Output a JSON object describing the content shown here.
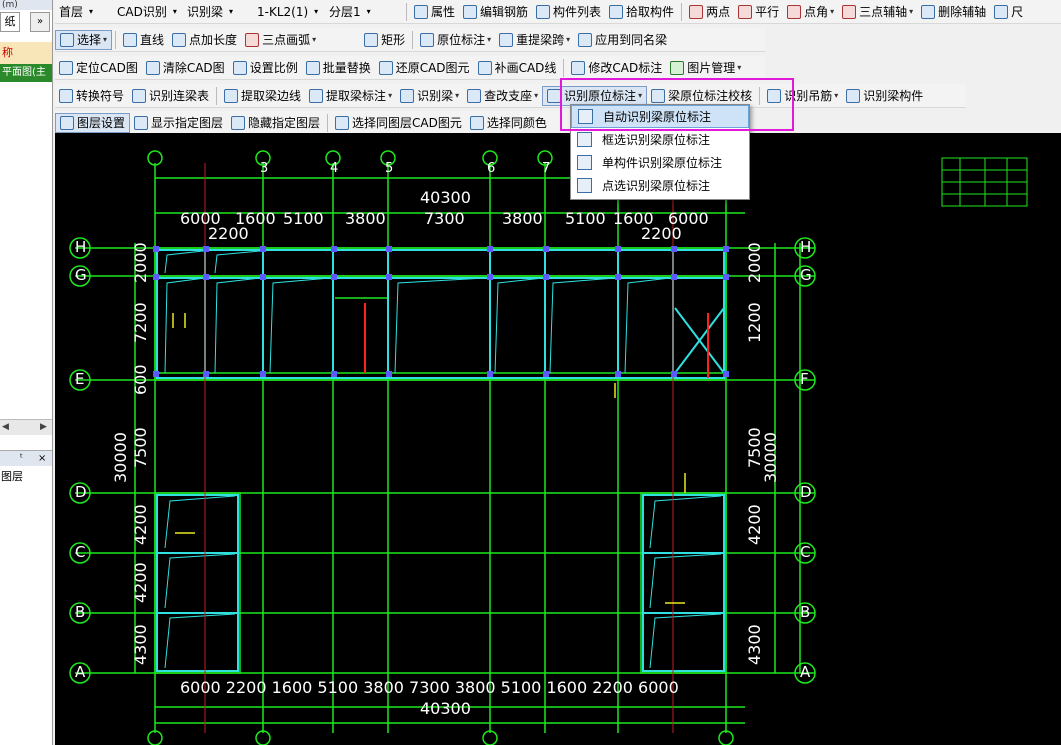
{
  "left_panel": {
    "head": "(m)",
    "tab": "纸",
    "chevron": "»",
    "name": "称",
    "plan": "平面图(主",
    "panel2_pin": "ᵗ",
    "panel2_close": "×",
    "layer": "图层"
  },
  "toolbar1": {
    "floor": "首层",
    "cad_recog": "CAD识别",
    "recog_beam": "识别梁",
    "component": "1-KL2(1)",
    "sublayer": "分层1",
    "items": [
      "属性",
      "编辑钢筋",
      "构件列表",
      "拾取构件",
      "两点",
      "平行",
      "点角",
      "三点辅轴",
      "删除辅轴",
      "尺"
    ]
  },
  "toolbar2": {
    "items": [
      "选择",
      "直线",
      "点加长度",
      "三点画弧",
      "矩形",
      "原位标注",
      "重提梁跨",
      "应用到同名梁"
    ]
  },
  "toolbar3": {
    "items": [
      "定位CAD图",
      "清除CAD图",
      "设置比例",
      "批量替换",
      "还原CAD图元",
      "补画CAD线",
      "修改CAD标注",
      "图片管理"
    ]
  },
  "toolbar4": {
    "items": [
      "转换符号",
      "识别连梁表",
      "提取梁边线",
      "提取梁标注",
      "识别梁",
      "查改支座",
      "识别原位标注",
      "梁原位标注校核",
      "识别吊筋",
      "识别梁构件"
    ]
  },
  "toolbar5": {
    "items": [
      "图层设置",
      "显示指定图层",
      "隐藏指定图层",
      "选择同图层CAD图元",
      "选择同颜色"
    ]
  },
  "dropdown": {
    "items": [
      "自动识别梁原位标注",
      "框选识别梁原位标注",
      "单构件识别梁原位标注",
      "点选识别梁原位标注"
    ]
  },
  "drawing": {
    "total_width": "40300",
    "spans_top": [
      "6000",
      "1600",
      "5100",
      "3800",
      "7300",
      "3800",
      "5100",
      "1600",
      "6000"
    ],
    "left_sub": "2200",
    "right_sub": "2200",
    "spans_bottom": "6000 2200 1600 5100 3800 7300 3800 5100 1600 2200 6000",
    "total_width_bottom": "40300",
    "total_height": "30000",
    "rows_left": [
      "2000",
      "1200",
      "7200",
      "600",
      "7500",
      "4200",
      "4200",
      "4300"
    ],
    "axes_right": [
      "H",
      "G",
      "F",
      "E",
      "D",
      "C",
      "B",
      "A"
    ],
    "axes_left": [
      "H",
      "G",
      "E",
      "D",
      "C",
      "B",
      "A"
    ],
    "axes_top": [
      "3",
      "4",
      "5",
      "6",
      "7"
    ]
  }
}
